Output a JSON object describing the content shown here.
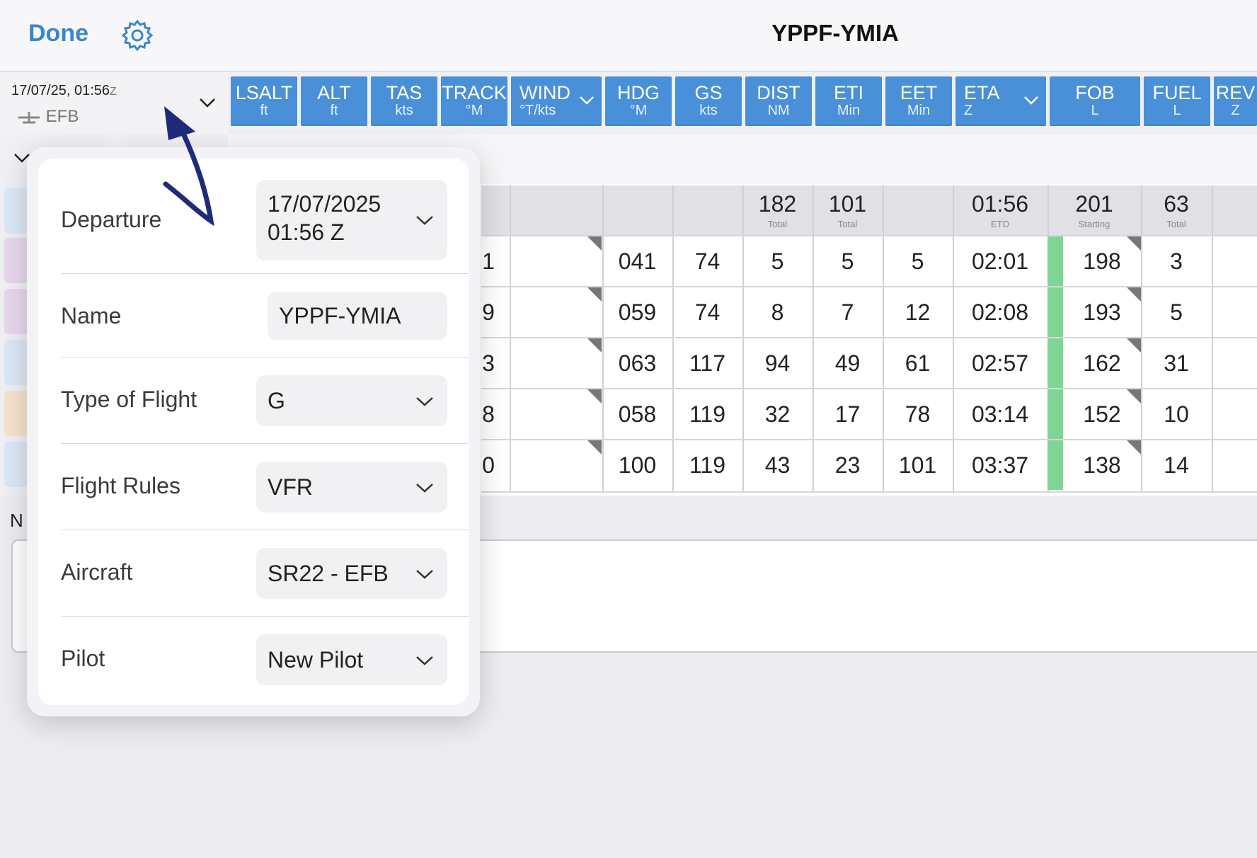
{
  "navbar": {
    "done_label": "Done",
    "title": "YPPF-YMIA"
  },
  "header": {
    "date_time": "17/07/25, 01:56",
    "tz": "Z",
    "aircraft": "EFB"
  },
  "columns": [
    {
      "label": "LSALT",
      "unit": "ft"
    },
    {
      "label": "ALT",
      "unit": "ft"
    },
    {
      "label": "TAS",
      "unit": "kts"
    },
    {
      "label": "TRACK",
      "unit": "°M"
    },
    {
      "label": "WIND",
      "unit": "°T/kts"
    },
    {
      "label": "HDG",
      "unit": "°M"
    },
    {
      "label": "GS",
      "unit": "kts"
    },
    {
      "label": "DIST",
      "unit": "NM"
    },
    {
      "label": "ETI",
      "unit": "Min"
    },
    {
      "label": "EET",
      "unit": "Min"
    },
    {
      "label": "ETA",
      "unit": "Z"
    },
    {
      "label": "FOB",
      "unit": "L"
    },
    {
      "label": "FUEL",
      "unit": "L"
    },
    {
      "label": "REV",
      "unit": "Z"
    }
  ],
  "totals": {
    "dist": {
      "value": "182",
      "sub": "Total"
    },
    "eti": {
      "value": "101",
      "sub": "Total"
    },
    "eta": {
      "value": "01:56",
      "sub": "ETD"
    },
    "fob": {
      "value": "201",
      "sub": "Starting"
    },
    "fuel": {
      "value": "63",
      "sub": "Total"
    }
  },
  "rows": [
    {
      "track_frag": "1",
      "hdg": "041",
      "gs": "74",
      "dist": "5",
      "eti": "5",
      "eet": "5",
      "eta": "02:01",
      "fob": "198",
      "fuel": "3"
    },
    {
      "track_frag": "9",
      "hdg": "059",
      "gs": "74",
      "dist": "8",
      "eti": "7",
      "eet": "12",
      "eta": "02:08",
      "fob": "193",
      "fuel": "5"
    },
    {
      "track_frag": "3",
      "hdg": "063",
      "gs": "117",
      "dist": "94",
      "eti": "49",
      "eet": "61",
      "eta": "02:57",
      "fob": "162",
      "fuel": "31"
    },
    {
      "track_frag": "8",
      "hdg": "058",
      "gs": "119",
      "dist": "32",
      "eti": "17",
      "eet": "78",
      "eta": "03:14",
      "fob": "152",
      "fuel": "10"
    },
    {
      "track_frag": "0",
      "hdg": "100",
      "gs": "119",
      "dist": "43",
      "eti": "23",
      "eet": "101",
      "eta": "03:37",
      "fob": "138",
      "fuel": "14"
    }
  ],
  "notes_label": "N",
  "popover": {
    "departure_label": "Departure",
    "departure_date": "17/07/2025",
    "departure_time": "01:56 Z",
    "name_label": "Name",
    "name_value": "YPPF-YMIA",
    "type_label": "Type of Flight",
    "type_value": "G",
    "rules_label": "Flight Rules",
    "rules_value": "VFR",
    "aircraft_label": "Aircraft",
    "aircraft_value": "SR22 - EFB",
    "pilot_label": "Pilot",
    "pilot_value": "New Pilot"
  },
  "colors": {
    "accent": "#4a90d9",
    "link": "#3a86c9",
    "fuel_ok": "#7fd694",
    "annotation": "#1f2a78"
  }
}
